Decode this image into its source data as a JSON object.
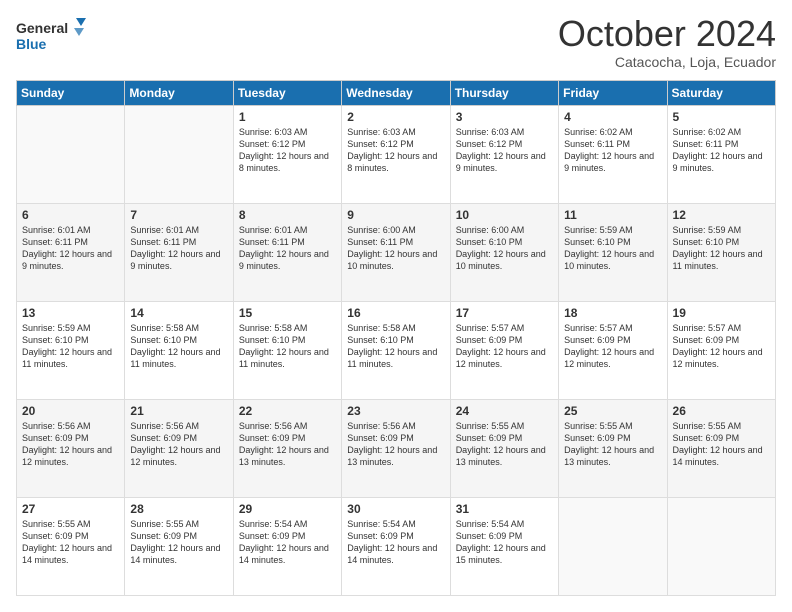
{
  "logo": {
    "line1": "General",
    "line2": "Blue"
  },
  "title": "October 2024",
  "location": "Catacocha, Loja, Ecuador",
  "days_of_week": [
    "Sunday",
    "Monday",
    "Tuesday",
    "Wednesday",
    "Thursday",
    "Friday",
    "Saturday"
  ],
  "weeks": [
    [
      {
        "num": "",
        "info": ""
      },
      {
        "num": "",
        "info": ""
      },
      {
        "num": "1",
        "info": "Sunrise: 6:03 AM\nSunset: 6:12 PM\nDaylight: 12 hours and 8 minutes."
      },
      {
        "num": "2",
        "info": "Sunrise: 6:03 AM\nSunset: 6:12 PM\nDaylight: 12 hours and 8 minutes."
      },
      {
        "num": "3",
        "info": "Sunrise: 6:03 AM\nSunset: 6:12 PM\nDaylight: 12 hours and 9 minutes."
      },
      {
        "num": "4",
        "info": "Sunrise: 6:02 AM\nSunset: 6:11 PM\nDaylight: 12 hours and 9 minutes."
      },
      {
        "num": "5",
        "info": "Sunrise: 6:02 AM\nSunset: 6:11 PM\nDaylight: 12 hours and 9 minutes."
      }
    ],
    [
      {
        "num": "6",
        "info": "Sunrise: 6:01 AM\nSunset: 6:11 PM\nDaylight: 12 hours and 9 minutes."
      },
      {
        "num": "7",
        "info": "Sunrise: 6:01 AM\nSunset: 6:11 PM\nDaylight: 12 hours and 9 minutes."
      },
      {
        "num": "8",
        "info": "Sunrise: 6:01 AM\nSunset: 6:11 PM\nDaylight: 12 hours and 9 minutes."
      },
      {
        "num": "9",
        "info": "Sunrise: 6:00 AM\nSunset: 6:11 PM\nDaylight: 12 hours and 10 minutes."
      },
      {
        "num": "10",
        "info": "Sunrise: 6:00 AM\nSunset: 6:10 PM\nDaylight: 12 hours and 10 minutes."
      },
      {
        "num": "11",
        "info": "Sunrise: 5:59 AM\nSunset: 6:10 PM\nDaylight: 12 hours and 10 minutes."
      },
      {
        "num": "12",
        "info": "Sunrise: 5:59 AM\nSunset: 6:10 PM\nDaylight: 12 hours and 11 minutes."
      }
    ],
    [
      {
        "num": "13",
        "info": "Sunrise: 5:59 AM\nSunset: 6:10 PM\nDaylight: 12 hours and 11 minutes."
      },
      {
        "num": "14",
        "info": "Sunrise: 5:58 AM\nSunset: 6:10 PM\nDaylight: 12 hours and 11 minutes."
      },
      {
        "num": "15",
        "info": "Sunrise: 5:58 AM\nSunset: 6:10 PM\nDaylight: 12 hours and 11 minutes."
      },
      {
        "num": "16",
        "info": "Sunrise: 5:58 AM\nSunset: 6:10 PM\nDaylight: 12 hours and 11 minutes."
      },
      {
        "num": "17",
        "info": "Sunrise: 5:57 AM\nSunset: 6:09 PM\nDaylight: 12 hours and 12 minutes."
      },
      {
        "num": "18",
        "info": "Sunrise: 5:57 AM\nSunset: 6:09 PM\nDaylight: 12 hours and 12 minutes."
      },
      {
        "num": "19",
        "info": "Sunrise: 5:57 AM\nSunset: 6:09 PM\nDaylight: 12 hours and 12 minutes."
      }
    ],
    [
      {
        "num": "20",
        "info": "Sunrise: 5:56 AM\nSunset: 6:09 PM\nDaylight: 12 hours and 12 minutes."
      },
      {
        "num": "21",
        "info": "Sunrise: 5:56 AM\nSunset: 6:09 PM\nDaylight: 12 hours and 12 minutes."
      },
      {
        "num": "22",
        "info": "Sunrise: 5:56 AM\nSunset: 6:09 PM\nDaylight: 12 hours and 13 minutes."
      },
      {
        "num": "23",
        "info": "Sunrise: 5:56 AM\nSunset: 6:09 PM\nDaylight: 12 hours and 13 minutes."
      },
      {
        "num": "24",
        "info": "Sunrise: 5:55 AM\nSunset: 6:09 PM\nDaylight: 12 hours and 13 minutes."
      },
      {
        "num": "25",
        "info": "Sunrise: 5:55 AM\nSunset: 6:09 PM\nDaylight: 12 hours and 13 minutes."
      },
      {
        "num": "26",
        "info": "Sunrise: 5:55 AM\nSunset: 6:09 PM\nDaylight: 12 hours and 14 minutes."
      }
    ],
    [
      {
        "num": "27",
        "info": "Sunrise: 5:55 AM\nSunset: 6:09 PM\nDaylight: 12 hours and 14 minutes."
      },
      {
        "num": "28",
        "info": "Sunrise: 5:55 AM\nSunset: 6:09 PM\nDaylight: 12 hours and 14 minutes."
      },
      {
        "num": "29",
        "info": "Sunrise: 5:54 AM\nSunset: 6:09 PM\nDaylight: 12 hours and 14 minutes."
      },
      {
        "num": "30",
        "info": "Sunrise: 5:54 AM\nSunset: 6:09 PM\nDaylight: 12 hours and 14 minutes."
      },
      {
        "num": "31",
        "info": "Sunrise: 5:54 AM\nSunset: 6:09 PM\nDaylight: 12 hours and 15 minutes."
      },
      {
        "num": "",
        "info": ""
      },
      {
        "num": "",
        "info": ""
      }
    ]
  ]
}
